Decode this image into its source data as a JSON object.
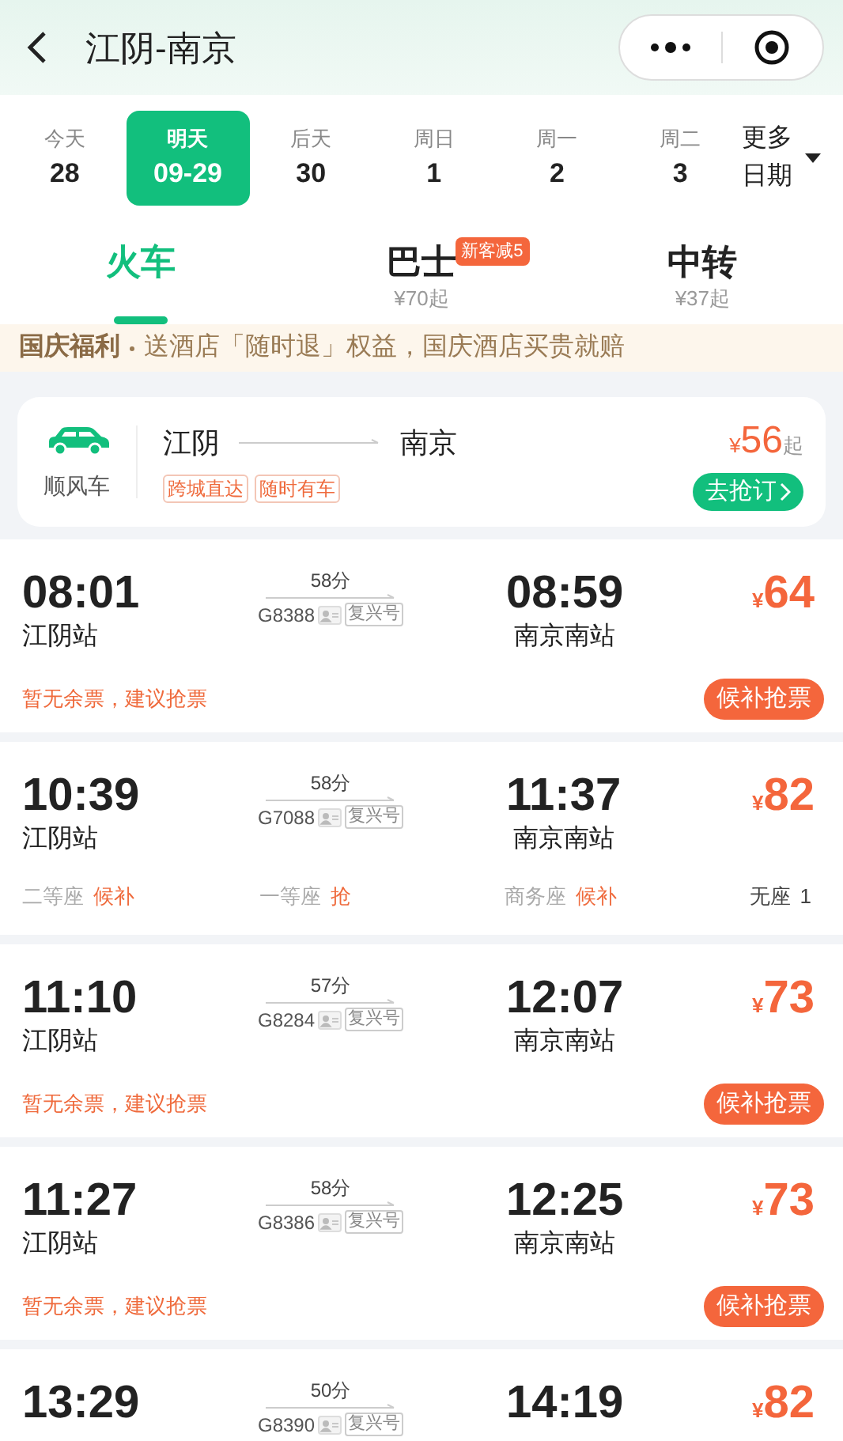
{
  "header": {
    "title": "江阴-南京"
  },
  "dates": [
    {
      "day": "今天",
      "date": "28",
      "selected": false
    },
    {
      "day": "明天",
      "date": "09-29",
      "selected": true
    },
    {
      "day": "后天",
      "date": "30",
      "selected": false
    },
    {
      "day": "周日",
      "date": "1",
      "selected": false
    },
    {
      "day": "周一",
      "date": "2",
      "selected": false
    },
    {
      "day": "周二",
      "date": "3",
      "selected": false
    }
  ],
  "more_dates": "更多日期",
  "modes": [
    {
      "label": "火车",
      "selected": true
    },
    {
      "label": "巴士",
      "sub": "¥70起",
      "badge": "新客减5",
      "selected": false
    },
    {
      "label": "中转",
      "sub": "¥37起",
      "selected": false
    }
  ],
  "promo": {
    "title": "国庆福利",
    "text": "送酒店「随时退」权益，国庆酒店买贵就赔"
  },
  "carpool": {
    "label": "顺风车",
    "from": "江阴",
    "to": "南京",
    "tags": [
      "跨城直达",
      "随时有车"
    ],
    "currency": "¥",
    "price": "56",
    "suffix": "起",
    "button": "去抢订"
  },
  "trains": [
    {
      "kind": "waitlist",
      "depart": "08:01",
      "from": "江阴站",
      "duration": "58分",
      "number": "G8388",
      "type": "复兴号",
      "arrive": "08:59",
      "to": "南京南站",
      "currency": "¥",
      "price": "64",
      "notice": "暂无余票，建议抢票",
      "button": "候补抢票"
    },
    {
      "kind": "seats",
      "depart": "10:39",
      "from": "江阴站",
      "duration": "58分",
      "number": "G7088",
      "type": "复兴号",
      "arrive": "11:37",
      "to": "南京南站",
      "currency": "¥",
      "price": "82",
      "seats": [
        {
          "class": "二等座",
          "status": "候补",
          "kind": "alert"
        },
        {
          "class": "一等座",
          "status": "抢",
          "kind": "alert"
        },
        {
          "class": "商务座",
          "status": "候补",
          "kind": "alert"
        },
        {
          "class": "无座",
          "status": "1",
          "kind": "count"
        }
      ]
    },
    {
      "kind": "waitlist",
      "depart": "11:10",
      "from": "江阴站",
      "duration": "57分",
      "number": "G8284",
      "type": "复兴号",
      "arrive": "12:07",
      "to": "南京南站",
      "currency": "¥",
      "price": "73",
      "notice": "暂无余票，建议抢票",
      "button": "候补抢票"
    },
    {
      "kind": "waitlist",
      "depart": "11:27",
      "from": "江阴站",
      "duration": "58分",
      "number": "G8386",
      "type": "复兴号",
      "arrive": "12:25",
      "to": "南京南站",
      "currency": "¥",
      "price": "73",
      "notice": "暂无余票，建议抢票",
      "button": "候补抢票"
    },
    {
      "kind": "partial",
      "depart": "13:29",
      "duration": "50分",
      "number": "G8390",
      "type": "复兴号",
      "arrive": "14:19",
      "currency": "¥",
      "price": "82"
    }
  ]
}
